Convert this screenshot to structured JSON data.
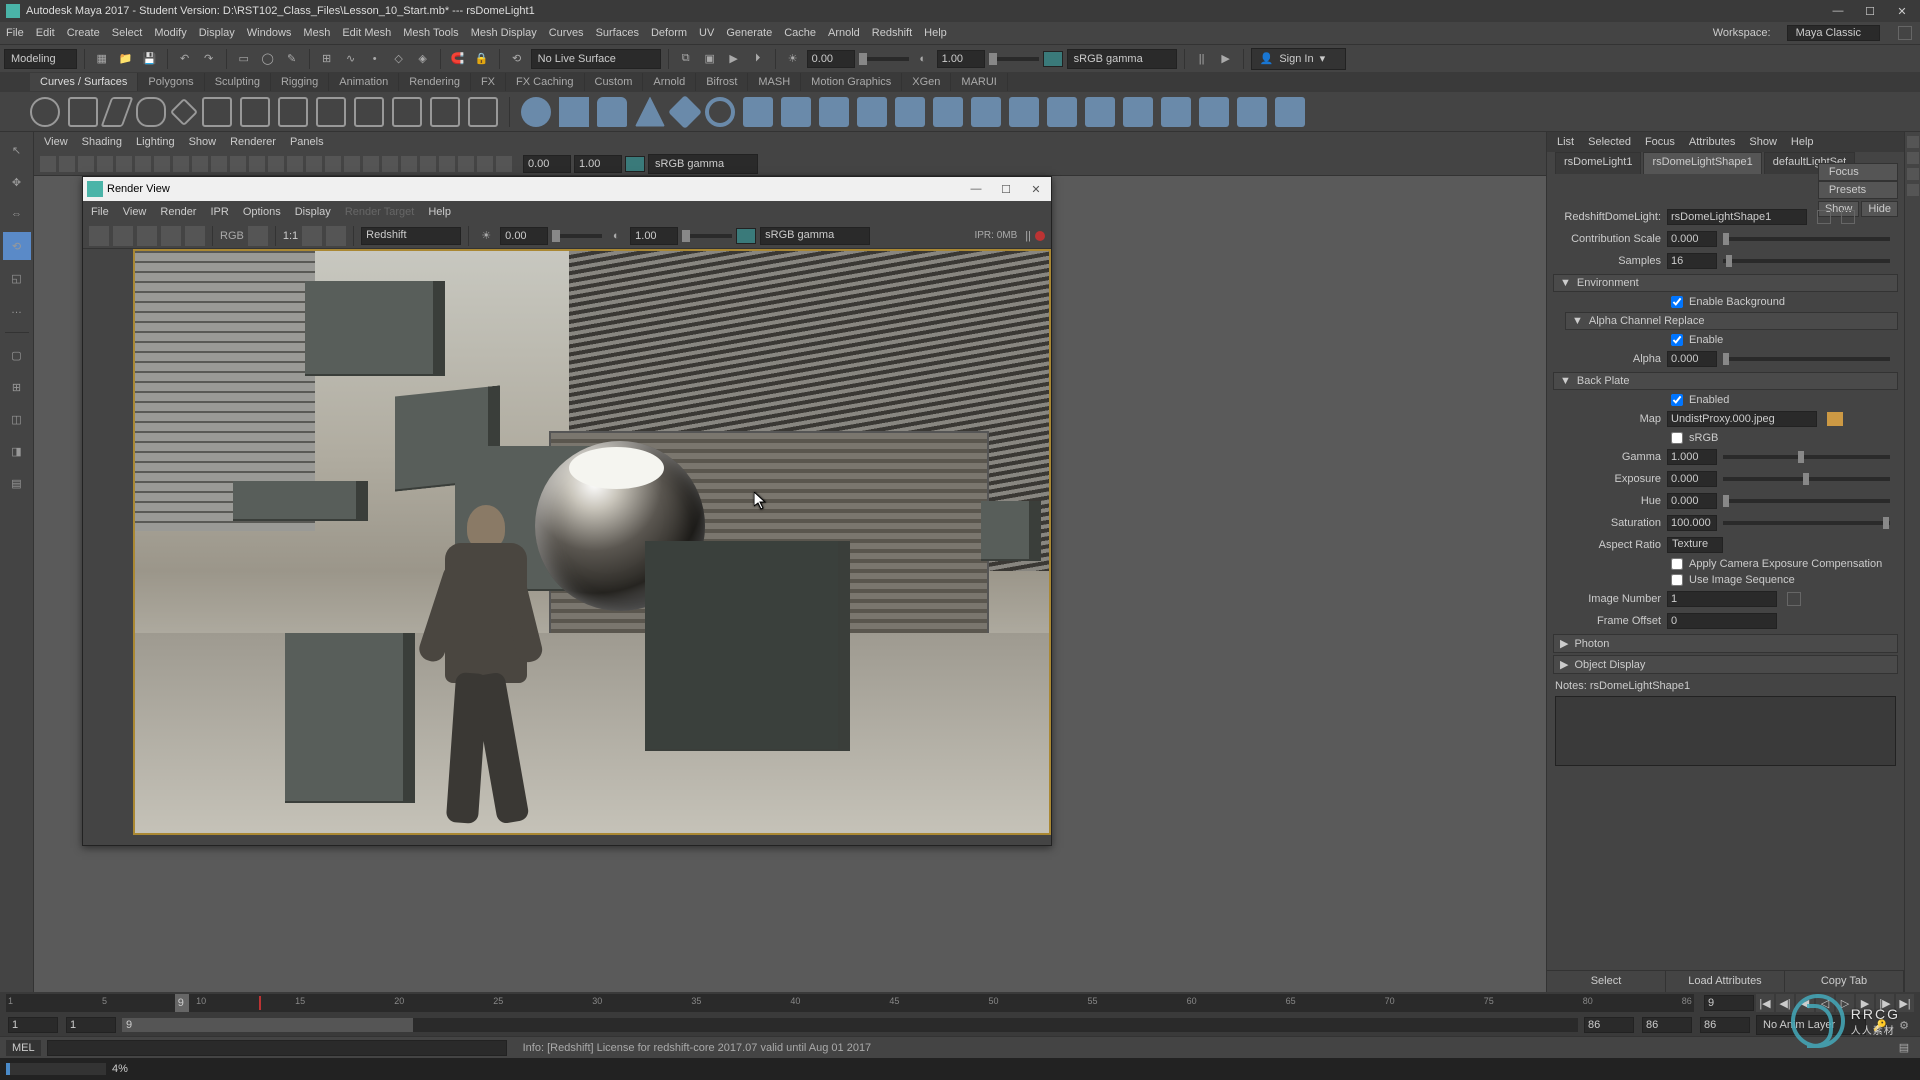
{
  "titlebar": {
    "title": "Autodesk Maya 2017 - Student Version: D:\\RST102_Class_Files\\Lesson_10_Start.mb* --- rsDomeLight1"
  },
  "menubar": {
    "items": [
      "File",
      "Edit",
      "Create",
      "Select",
      "Modify",
      "Display",
      "Windows",
      "Mesh",
      "Edit Mesh",
      "Mesh Tools",
      "Mesh Display",
      "Curves",
      "Surfaces",
      "Deform",
      "UV",
      "Generate",
      "Cache",
      "Arnold",
      "Redshift",
      "Help"
    ],
    "workspace_label": "Workspace:",
    "workspace_value": "Maya Classic"
  },
  "toolbar1": {
    "mode": "Modeling",
    "nolivesurface": "No Live Surface",
    "signin": "Sign In",
    "num1": "0.00",
    "num2": "1.00",
    "colorspace": "sRGB gamma"
  },
  "shelftabs": [
    "Curves / Surfaces",
    "Polygons",
    "Sculpting",
    "Rigging",
    "Animation",
    "Rendering",
    "FX",
    "FX Caching",
    "Custom",
    "Arnold",
    "Bifrost",
    "MASH",
    "Motion Graphics",
    "XGen",
    "MARUI"
  ],
  "panelmenus": [
    "View",
    "Shading",
    "Lighting",
    "Show",
    "Renderer",
    "Panels"
  ],
  "renderview": {
    "title": "Render View",
    "menu": [
      "File",
      "View",
      "Render",
      "IPR",
      "Options",
      "Display",
      "Render Target",
      "Help"
    ],
    "renderer": "Redshift",
    "num1": "0.00",
    "num2": "1.00",
    "colorspace": "sRGB gamma",
    "ipr": "IPR: 0MB",
    "ratio": "1:1"
  },
  "attrEditor": {
    "tabs": [
      "List",
      "Selected",
      "Focus",
      "Attributes",
      "Show",
      "Help"
    ],
    "btn_focus": "Focus",
    "btn_presets": "Presets",
    "btn_show": "Show",
    "btn_hide": "Hide",
    "nodetabs": [
      "rsDomeLight1",
      "rsDomeLightShape1",
      "defaultLightSet"
    ],
    "typeLabel": "RedshiftDomeLight:",
    "typeValue": "rsDomeLightShape1",
    "contribScale": {
      "label": "Contribution Scale",
      "value": "0.000"
    },
    "samples": {
      "label": "Samples",
      "value": "16"
    },
    "env": {
      "title": "Environment",
      "enableBg": "Enable Background"
    },
    "alpha": {
      "title": "Alpha Channel Replace",
      "enable": "Enable",
      "alphaLabel": "Alpha",
      "alphaVal": "0.000"
    },
    "backplate": {
      "title": "Back Plate",
      "enabled": "Enabled",
      "mapLabel": "Map",
      "mapVal": "UndistProxy.000.jpeg",
      "srgb": "sRGB",
      "gammaLabel": "Gamma",
      "gammaVal": "1.000",
      "exposureLabel": "Exposure",
      "exposureVal": "0.000",
      "hueLabel": "Hue",
      "hueVal": "0.000",
      "satLabel": "Saturation",
      "satVal": "100.000",
      "aspectLabel": "Aspect Ratio",
      "aspectVal": "Texture",
      "applyCam": "Apply Camera Exposure Compensation",
      "useSeq": "Use Image Sequence",
      "imgNumLabel": "Image Number",
      "imgNumVal": "1",
      "frameOffLabel": "Frame Offset",
      "frameOffVal": "0"
    },
    "photon": "Photon",
    "objDisplay": "Object Display",
    "notesLabel": "Notes: rsDomeLightShape1",
    "footer": [
      "Select",
      "Load Attributes",
      "Copy Tab"
    ]
  },
  "timeline": {
    "ticks": [
      "1",
      "5",
      "10",
      "15",
      "20",
      "25",
      "30",
      "35",
      "40",
      "45",
      "50",
      "55",
      "60",
      "65",
      "70",
      "75",
      "80",
      "86"
    ],
    "current": "9"
  },
  "range": {
    "start": "1",
    "startB": "1",
    "cur": "9",
    "end": "86",
    "endB": "86",
    "endC": "86",
    "animLayer": "No Anim Layer"
  },
  "cmd": {
    "lang": "MEL",
    "help": "Info: [Redshift] License for redshift-core 2017.07 valid until Aug 01 2017"
  },
  "status": {
    "percent": "4%"
  },
  "watermark": {
    "brand": "RRCG",
    "sub": "人人素材"
  }
}
